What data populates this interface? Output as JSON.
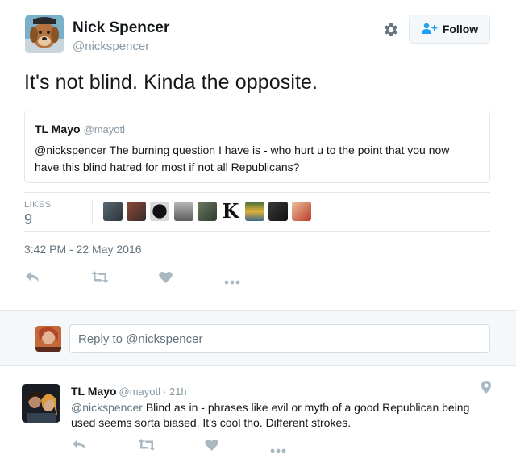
{
  "tweet": {
    "author_name": "Nick Spencer",
    "author_handle": "@nickspencer",
    "follow_label": "Follow",
    "text": "It's not blind. Kinda the opposite.",
    "quoted": {
      "name": "TL Mayo",
      "handle": "@mayotl",
      "line1": "@nickspencer The burning question I have is - who hurt u to the point that you now",
      "line2": "have this blind hatred for most if not all Republicans?"
    },
    "likes_label": "LIKES",
    "likes_count": "9",
    "timestamp": "3:42 PM - 22 May 2016"
  },
  "reply_box": {
    "placeholder": "Reply to @nickspencer"
  },
  "reply": {
    "name": "TL Mayo",
    "handle": "@mayotl",
    "time": "· 21h",
    "mention": "@nickspencer",
    "text_line1": "Blind as in - phrases like evil or myth of a good Republican being",
    "text_line2": "used seems sorta biased.  It's cool tho. Different strokes."
  },
  "colors": {
    "text": "#14171a",
    "muted": "#8899a6",
    "action_icon": "#aab8c2",
    "border": "#e1e8ed",
    "follow_icon": "#1da1f2"
  },
  "icons": {
    "settings": "gear-icon",
    "follow": "add-user-icon",
    "reply": "reply-icon",
    "retweet": "retweet-icon",
    "like": "heart-icon",
    "more": "more-icon",
    "location": "location-pin-icon"
  }
}
